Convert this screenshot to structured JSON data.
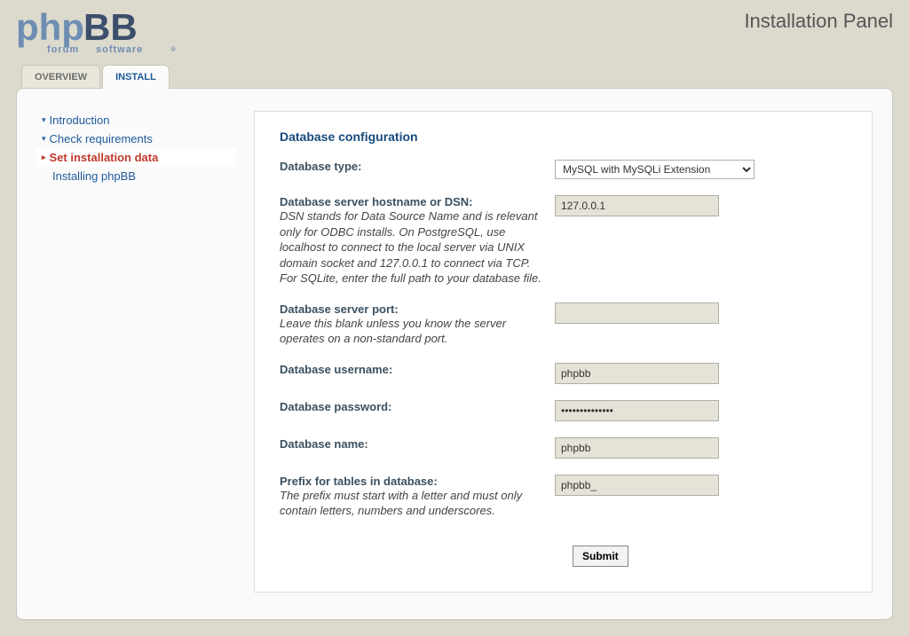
{
  "header": {
    "page_title": "Installation Panel"
  },
  "tabs": [
    {
      "label": "OVERVIEW",
      "active": false
    },
    {
      "label": "INSTALL",
      "active": true
    }
  ],
  "sidenav": [
    {
      "label": "Introduction",
      "active": false
    },
    {
      "label": "Check requirements",
      "active": false
    },
    {
      "label": "Set installation data",
      "active": true
    },
    {
      "label": "Installing phpBB",
      "active": false
    }
  ],
  "form": {
    "section_title": "Database configuration",
    "db_type": {
      "label": "Database type:",
      "selected": "MySQL with MySQLi Extension"
    },
    "db_host": {
      "label": "Database server hostname or DSN:",
      "hint": "DSN stands for Data Source Name and is relevant only for ODBC installs. On PostgreSQL, use localhost to connect to the local server via UNIX domain socket and 127.0.0.1 to connect via TCP. For SQLite, enter the full path to your database file.",
      "value": "127.0.0.1"
    },
    "db_port": {
      "label": "Database server port:",
      "hint": "Leave this blank unless you know the server operates on a non-standard port.",
      "value": ""
    },
    "db_user": {
      "label": "Database username:",
      "value": "phpbb"
    },
    "db_pass": {
      "label": "Database password:",
      "value": "••••••••••••••"
    },
    "db_name": {
      "label": "Database name:",
      "value": "phpbb"
    },
    "db_prefix": {
      "label": "Prefix for tables in database:",
      "hint": "The prefix must start with a letter and must only contain letters, numbers and underscores.",
      "value": "phpbb_"
    },
    "submit_label": "Submit"
  }
}
